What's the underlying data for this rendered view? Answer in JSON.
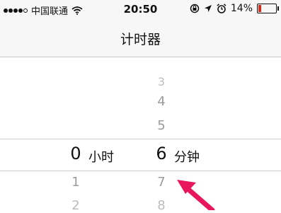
{
  "status": {
    "carrier": "中国联通",
    "time": "20:50",
    "battery": "14%",
    "signal_bars": 4
  },
  "nav": {
    "title": "计时器"
  },
  "picker": {
    "hours": {
      "above": [],
      "selected": "0",
      "below": [
        "1",
        "2"
      ],
      "unit": "小时"
    },
    "minutes": {
      "above": [
        "3",
        "4",
        "5"
      ],
      "selected": "6",
      "below": [
        "7",
        "8"
      ],
      "unit": "分钟"
    }
  },
  "colors": {
    "battery_low": "#e0261b",
    "arrow": "#e8175d"
  }
}
